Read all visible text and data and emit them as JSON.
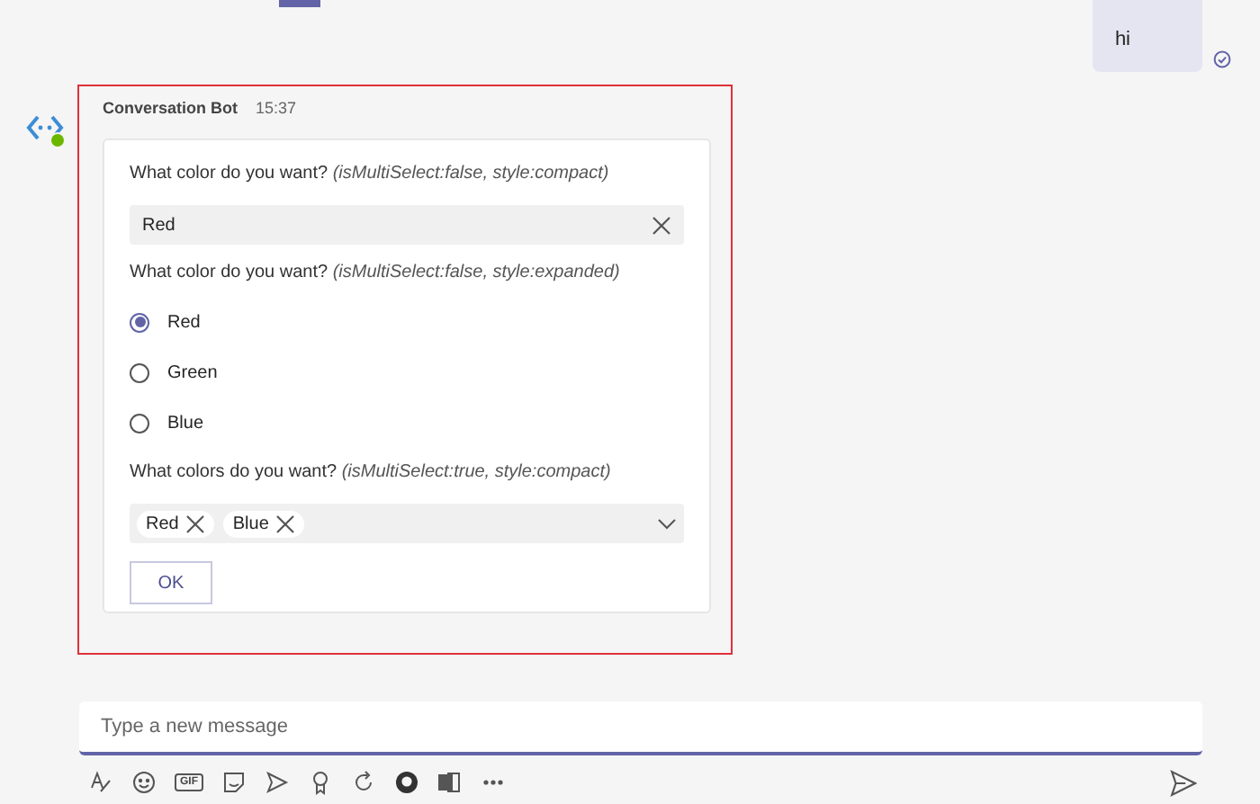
{
  "sent_message": {
    "text": "hi",
    "read": true
  },
  "bot_message": {
    "sender": "Conversation Bot",
    "time": "15:37",
    "online": true,
    "highlighted": true,
    "card": {
      "compact_single": {
        "label": "What color do you want?",
        "hint": "(isMultiSelect:false, style:compact)",
        "value": "Red"
      },
      "expanded_single": {
        "label": "What color do you want?",
        "hint": "(isMultiSelect:false, style:expanded)",
        "options": [
          {
            "label": "Red",
            "selected": true
          },
          {
            "label": "Green",
            "selected": false
          },
          {
            "label": "Blue",
            "selected": false
          }
        ]
      },
      "compact_multi": {
        "label": "What colors do you want?",
        "hint": "(isMultiSelect:true, style:compact)",
        "chips": [
          "Red",
          "Blue"
        ]
      },
      "submit_button": "OK"
    }
  },
  "composer": {
    "placeholder": "Type a new message",
    "gif_label": "GIF"
  }
}
